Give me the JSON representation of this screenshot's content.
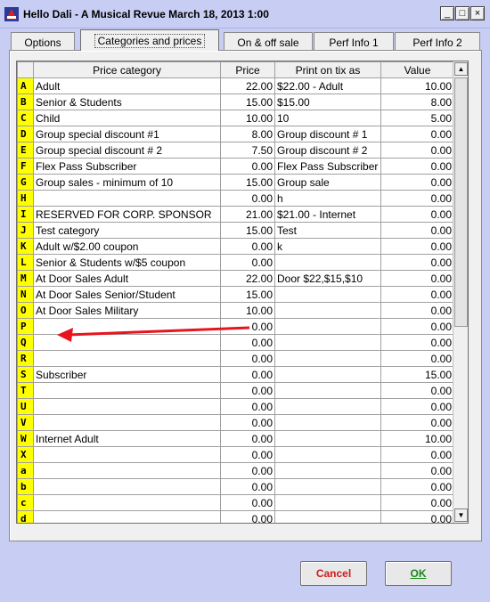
{
  "window": {
    "title": "Hello Dali - A Musical Revue March 18, 2013 1:00",
    "minimize_label": "_",
    "maximize_label": "□",
    "close_label": "×"
  },
  "tabs": [
    {
      "label": "Options",
      "active": false
    },
    {
      "label": "Categories and prices",
      "active": true
    },
    {
      "label": "On & off sale",
      "active": false
    },
    {
      "label": "Perf Info 1",
      "active": false
    },
    {
      "label": "Perf Info 2",
      "active": false
    }
  ],
  "grid": {
    "columns": [
      "",
      "Price category",
      "Price",
      "Print on tix as",
      "Value"
    ],
    "rows": [
      {
        "code": "A",
        "category": "Adult",
        "price": "22.00",
        "print": "$22.00 - Adult",
        "value": "10.00"
      },
      {
        "code": "B",
        "category": "Senior & Students",
        "price": "15.00",
        "print": "$15.00",
        "value": "8.00"
      },
      {
        "code": "C",
        "category": "Child",
        "price": "10.00",
        "print": "10",
        "value": "5.00"
      },
      {
        "code": "D",
        "category": "Group special discount #1",
        "price": "8.00",
        "print": "Group discount # 1",
        "value": "0.00"
      },
      {
        "code": "E",
        "category": "Group special discount # 2",
        "price": "7.50",
        "print": "Group discount # 2",
        "value": "0.00"
      },
      {
        "code": "F",
        "category": "Flex Pass Subscriber",
        "price": "0.00",
        "print": "Flex Pass Subscriber",
        "value": "0.00"
      },
      {
        "code": "G",
        "category": "Group sales - minimum of 10",
        "price": "15.00",
        "print": "Group sale",
        "value": "0.00"
      },
      {
        "code": "H",
        "category": "",
        "price": "0.00",
        "print": "h",
        "value": "0.00"
      },
      {
        "code": "I",
        "category": "RESERVED FOR CORP. SPONSOR",
        "price": "21.00",
        "print": "$21.00 - Internet",
        "value": "0.00"
      },
      {
        "code": "J",
        "category": "Test category",
        "price": "15.00",
        "print": "Test",
        "value": "0.00"
      },
      {
        "code": "K",
        "category": "Adult w/$2.00 coupon",
        "price": "0.00",
        "print": "k",
        "value": "0.00"
      },
      {
        "code": "L",
        "category": "Senior & Students w/$5 coupon",
        "price": "0.00",
        "print": "",
        "value": "0.00"
      },
      {
        "code": "M",
        "category": "At Door Sales Adult",
        "price": "22.00",
        "print": "Door $22,$15,$10",
        "value": "0.00"
      },
      {
        "code": "N",
        "category": "At Door Sales Senior/Student",
        "price": "15.00",
        "print": "",
        "value": "0.00"
      },
      {
        "code": "O",
        "category": "At Door Sales Military",
        "price": "10.00",
        "print": "",
        "value": "0.00"
      },
      {
        "code": "P",
        "category": "",
        "price": "0.00",
        "print": "",
        "value": "0.00"
      },
      {
        "code": "Q",
        "category": "",
        "price": "0.00",
        "print": "",
        "value": "0.00"
      },
      {
        "code": "R",
        "category": "",
        "price": "0.00",
        "print": "",
        "value": "0.00"
      },
      {
        "code": "S",
        "category": "Subscriber",
        "price": "0.00",
        "print": "",
        "value": "15.00"
      },
      {
        "code": "T",
        "category": "",
        "price": "0.00",
        "print": "",
        "value": "0.00"
      },
      {
        "code": "U",
        "category": "",
        "price": "0.00",
        "print": "",
        "value": "0.00"
      },
      {
        "code": "V",
        "category": "",
        "price": "0.00",
        "print": "",
        "value": "0.00"
      },
      {
        "code": "W",
        "category": "Internet Adult",
        "price": "0.00",
        "print": "",
        "value": "10.00"
      },
      {
        "code": "X",
        "category": "",
        "price": "0.00",
        "print": "",
        "value": "0.00"
      },
      {
        "code": "a",
        "category": "",
        "price": "0.00",
        "print": "",
        "value": "0.00"
      },
      {
        "code": "b",
        "category": "",
        "price": "0.00",
        "print": "",
        "value": "0.00"
      },
      {
        "code": "c",
        "category": "",
        "price": "0.00",
        "print": "",
        "value": "0.00"
      },
      {
        "code": "d",
        "category": "",
        "price": "0.00",
        "print": "",
        "value": "0.00"
      }
    ]
  },
  "buttons": {
    "cancel": "Cancel",
    "ok": "OK"
  },
  "colors": {
    "code_cell": "#ffff00",
    "annotation_arrow": "#e8141e",
    "cancel_text": "#cc1a1a",
    "ok_text": "#1a8a1a"
  },
  "icons": {
    "app": "app-logo-icon",
    "scroll_up": "scroll-up-arrow-icon",
    "scroll_down": "scroll-down-arrow-icon",
    "annotation": "red-arrow-annotation-icon"
  }
}
